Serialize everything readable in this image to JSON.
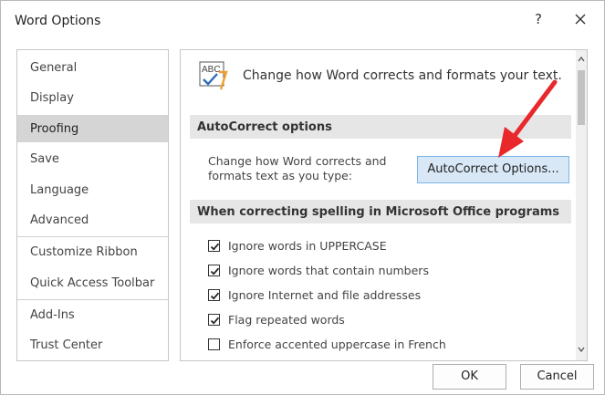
{
  "window": {
    "title": "Word Options",
    "help_glyph": "?",
    "close_icon": "close-icon"
  },
  "sidebar": {
    "items": [
      {
        "label": "General",
        "active": false
      },
      {
        "label": "Display",
        "active": false
      },
      {
        "label": "Proofing",
        "active": true
      },
      {
        "label": "Save",
        "active": false
      },
      {
        "label": "Language",
        "active": false
      },
      {
        "label": "Advanced",
        "active": false
      },
      {
        "label": "Customize Ribbon",
        "active": false
      },
      {
        "label": "Quick Access Toolbar",
        "active": false
      },
      {
        "label": "Add-Ins",
        "active": false
      },
      {
        "label": "Trust Center",
        "active": false
      }
    ]
  },
  "main": {
    "header_icon": "abc-spellcheck-icon",
    "header_text": "Change how Word corrects and formats your text.",
    "autocorrect_section": {
      "title": "AutoCorrect options",
      "description_line1": "Change how Word corrects and",
      "description_line2": "formats text as you type:",
      "button_label": "AutoCorrect Options..."
    },
    "spelling_section": {
      "title": "When correcting spelling in Microsoft Office programs",
      "options": [
        {
          "label": "Ignore words in UPPERCASE",
          "checked": true
        },
        {
          "label": "Ignore words that contain numbers",
          "checked": true
        },
        {
          "label": "Ignore Internet and file addresses",
          "checked": true
        },
        {
          "label": "Flag repeated words",
          "checked": true
        },
        {
          "label": "Enforce accented uppercase in French",
          "checked": false
        }
      ]
    }
  },
  "footer": {
    "ok_label": "OK",
    "cancel_label": "Cancel"
  },
  "colors": {
    "accent_button_bg": "#d9e8f7",
    "accent_button_border": "#7eb4ea",
    "selected_nav_bg": "#d5d5d5",
    "section_header_bg": "#e6e6e6",
    "annotation_arrow": "#e8282b"
  }
}
